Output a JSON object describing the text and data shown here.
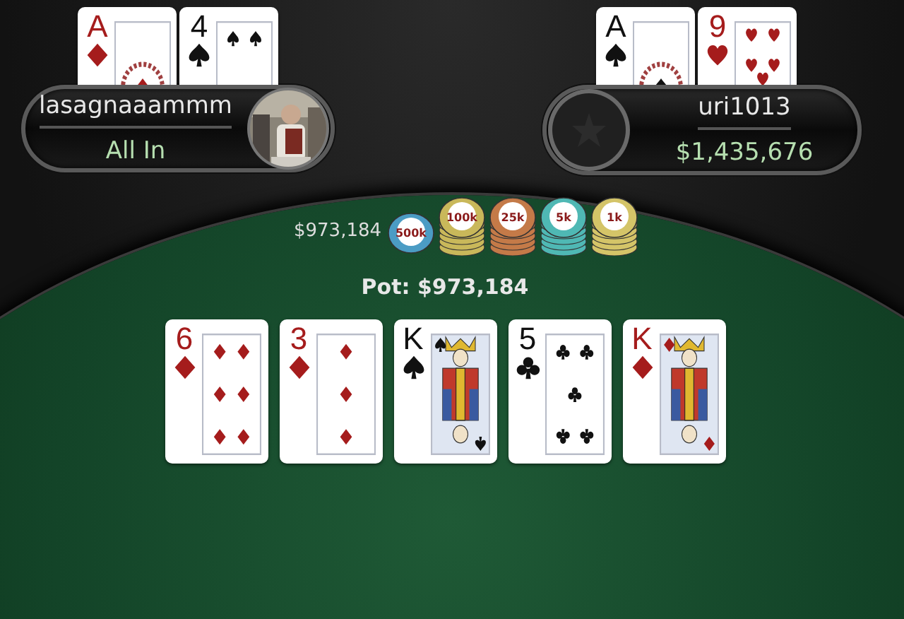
{
  "players": [
    {
      "name": "lasagnaaammm",
      "status": "All In",
      "hole_cards": [
        {
          "rank": "A",
          "kind": "diamonds"
        },
        {
          "rank": "4",
          "kind": "spades"
        }
      ]
    },
    {
      "name": "uri1013",
      "status": "$1,435,676",
      "avatar": {
        "kind": "default"
      },
      "hole_cards": [
        {
          "rank": "A",
          "kind": "spades"
        },
        {
          "rank": "9",
          "kind": "hearts"
        }
      ]
    }
  ],
  "bet": {
    "amount": "$973,184",
    "chips": [
      {
        "label": "500k",
        "color": "#4b9cc4",
        "kind": "single"
      },
      {
        "label": "100k",
        "color": "#c9b85a",
        "kind": "stack"
      },
      {
        "label": "25k",
        "color": "#c47a48",
        "kind": "stack"
      },
      {
        "label": "5k",
        "color": "#4fb8b4",
        "kind": "stack"
      },
      {
        "label": "1k",
        "color": "#d4c468",
        "kind": "stack"
      }
    ]
  },
  "pot": "Pot: $973,184",
  "board": [
    {
      "rank": "6",
      "kind": "diamonds"
    },
    {
      "rank": "3",
      "kind": "diamonds"
    },
    {
      "rank": "K",
      "kind": "spades"
    },
    {
      "rank": "5",
      "kind": "clubs"
    },
    {
      "rank": "K",
      "kind": "diamonds"
    }
  ]
}
